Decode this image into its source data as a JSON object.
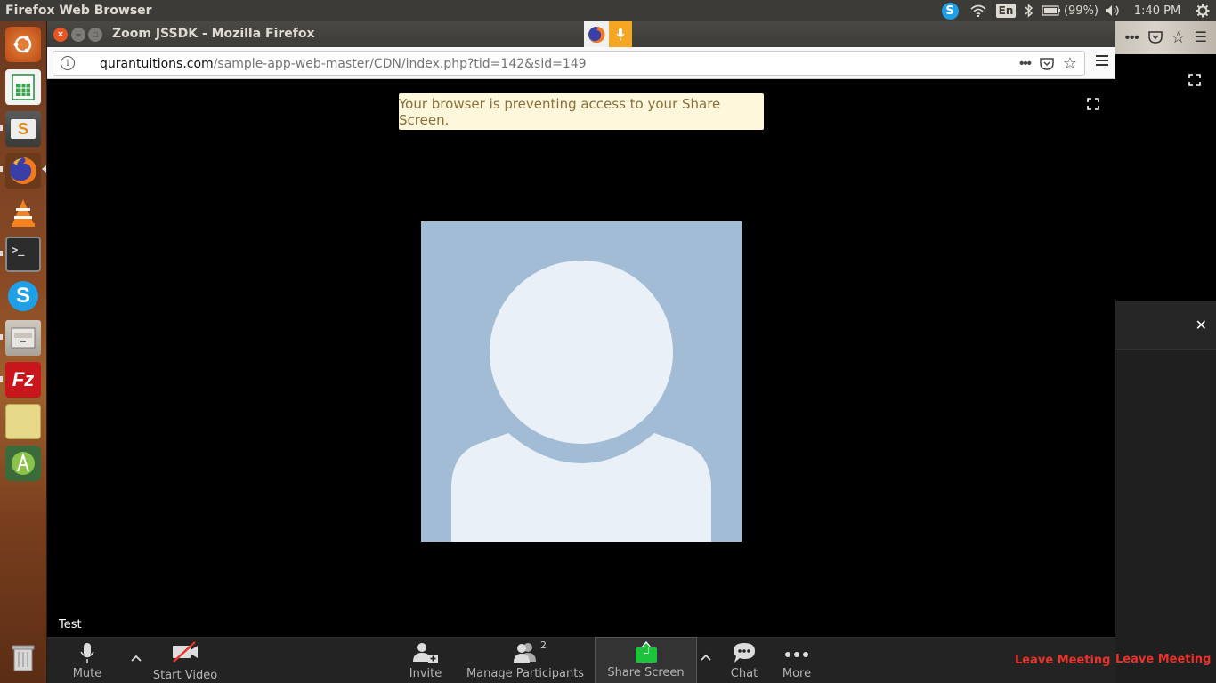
{
  "top_panel": {
    "app_title": "Firefox Web Browser",
    "keyboard": "En",
    "battery": "(99%)",
    "clock": "1:40 PM",
    "icons": [
      "skype-icon",
      "wifi-icon",
      "bluetooth-icon",
      "battery-icon",
      "volume-icon",
      "gear-icon"
    ]
  },
  "launcher": {
    "items": [
      "ubuntu-dash",
      "libreoffice-calc",
      "sublime-text",
      "firefox",
      "vlc",
      "terminal",
      "skype",
      "files",
      "filezilla",
      "sticky-notes",
      "android-studio",
      "trash"
    ]
  },
  "window": {
    "title": "Zoom JSSDK - Mozilla Firefox"
  },
  "urlbar": {
    "domain": "qurantuitions.com",
    "path": "/sample-app-web-master/CDN/index.php?tid=142&sid=149",
    "actions": [
      "•••",
      "pocket-icon",
      "☆"
    ]
  },
  "meeting": {
    "notice": "Your browser is preventing access to your Share Screen.",
    "participant_name": "Test"
  },
  "toolbar": {
    "mute": "Mute",
    "start_video": "Start Video",
    "invite": "Invite",
    "manage_participants": "Manage Participants",
    "participants_count": "2",
    "share_screen": "Share Screen",
    "chat": "Chat",
    "more": "More",
    "leave": "Leave Meeting",
    "leave_right": "Leave Meeting",
    "caret": "^"
  },
  "colors": {
    "share_green": "#1cc33d",
    "leave_red": "#e8322a",
    "notice_bg": "#fff7db",
    "avatar_bg": "#a3bcd6",
    "avatar_fg": "#e9f0f7"
  }
}
